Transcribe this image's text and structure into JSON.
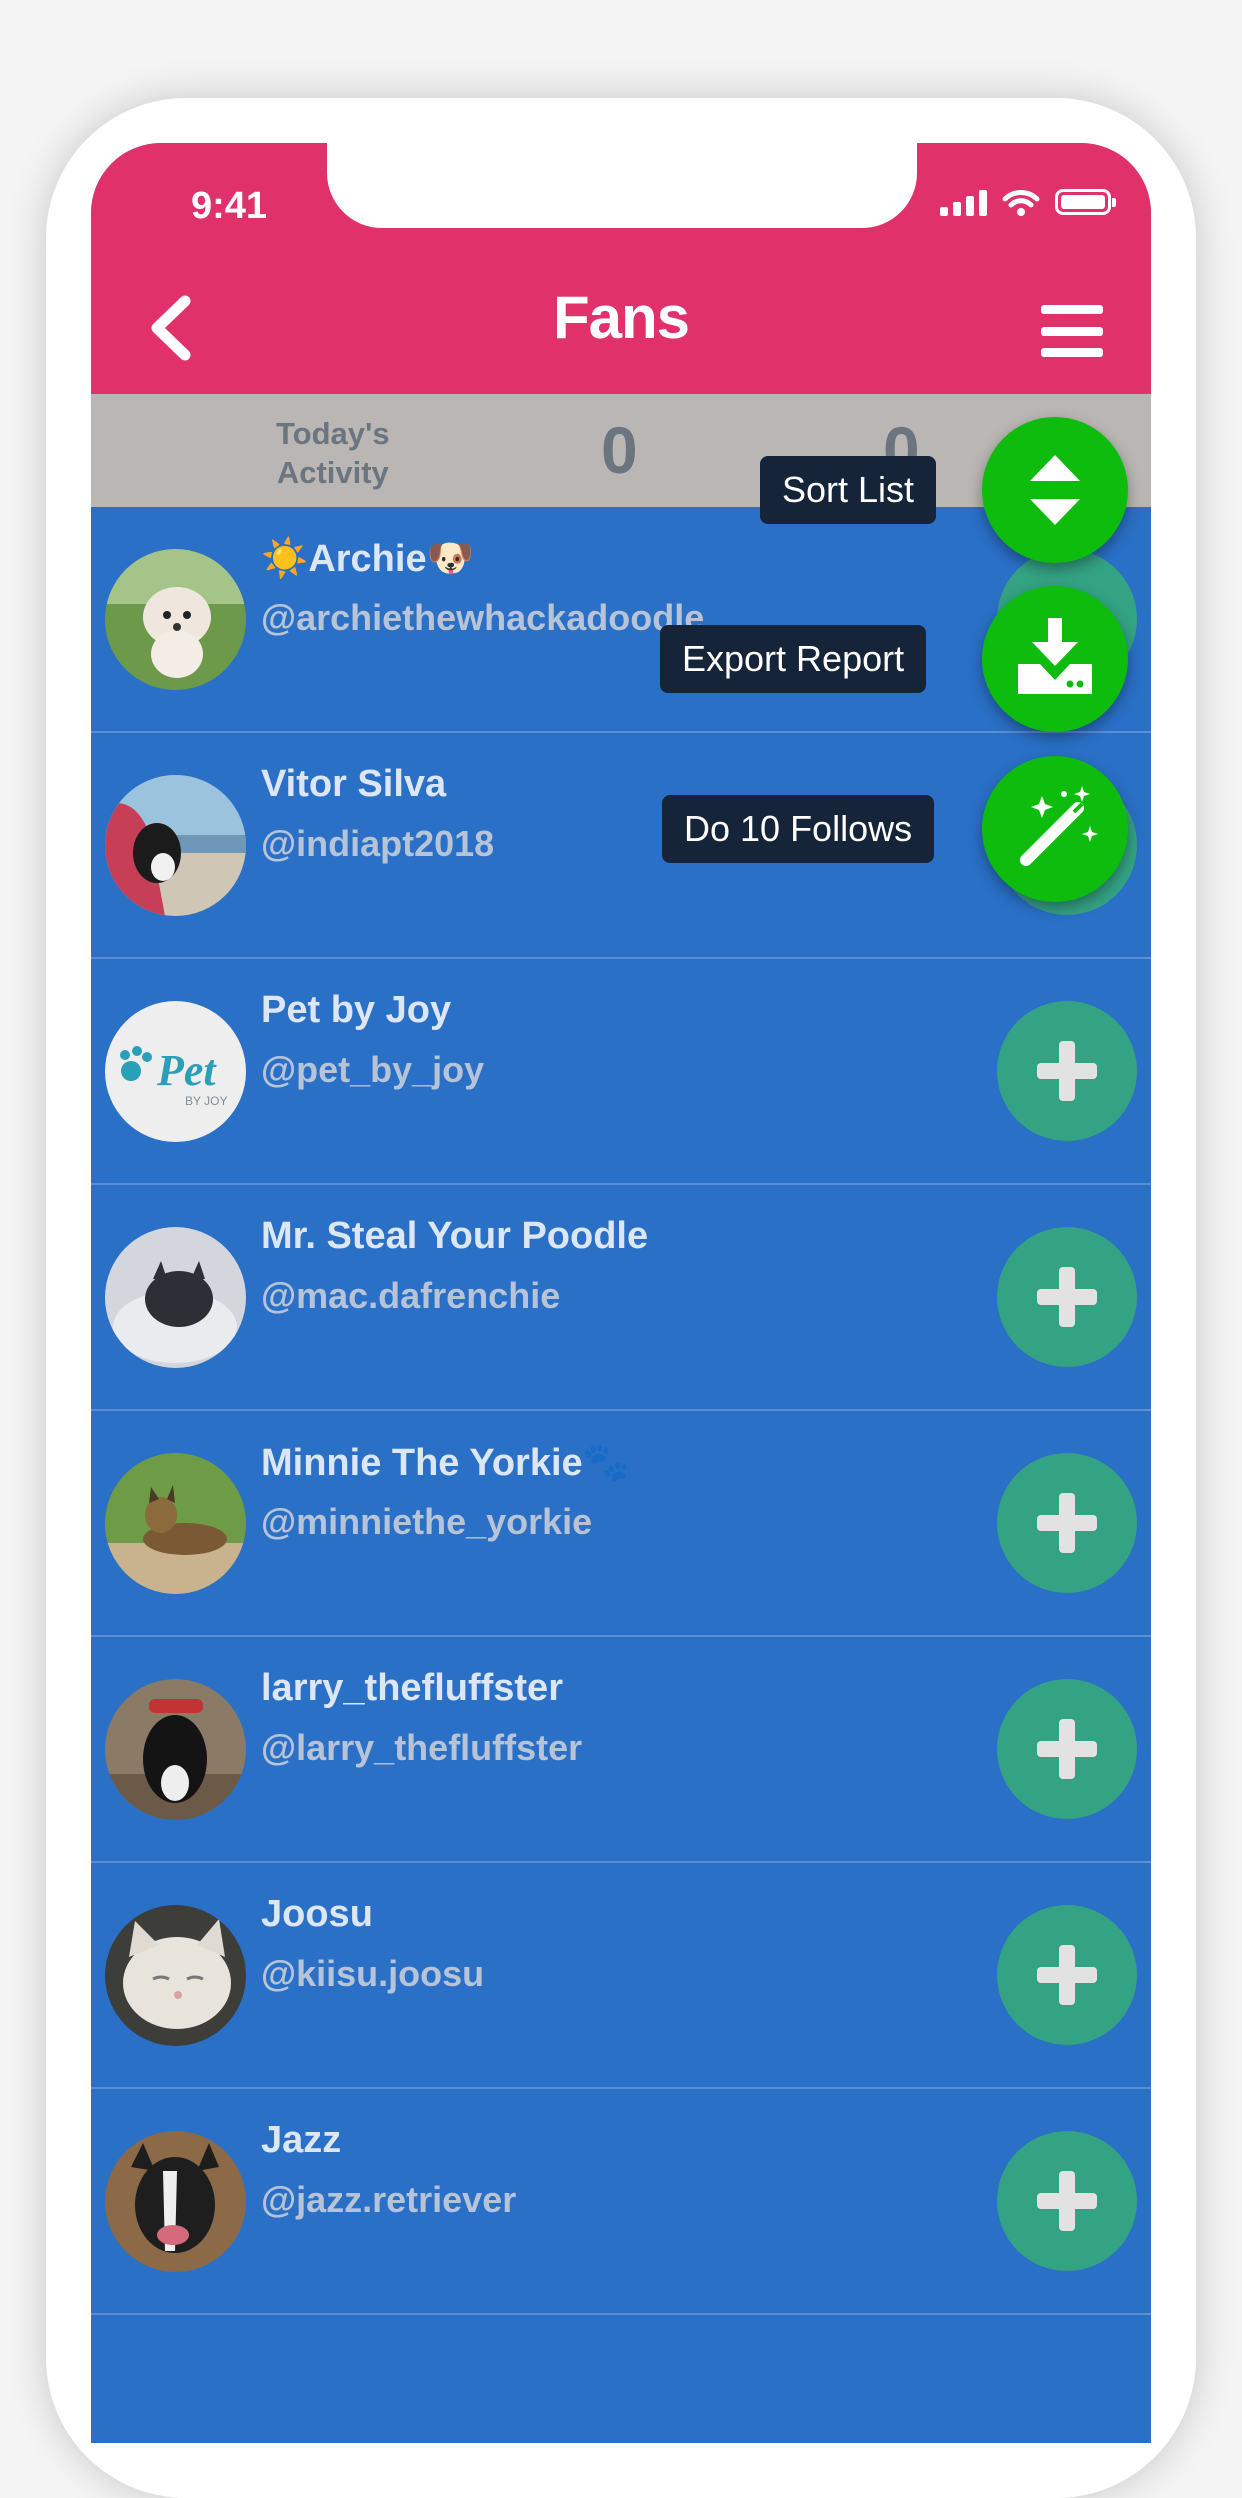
{
  "status_bar": {
    "time": "9:41"
  },
  "header": {
    "title": "Fans"
  },
  "activity": {
    "label_line1": "Today's",
    "label_line2": "Activity",
    "count1": "0",
    "count2": "0"
  },
  "fab_menu": {
    "sort_label": "Sort List",
    "export_label": "Export Report",
    "follow_label": "Do 10 Follows"
  },
  "fans": [
    {
      "name": "☀️Archie🐶",
      "handle": "@archiethewhackadoodle"
    },
    {
      "name": "Vitor Silva",
      "handle": "@indiapt2018"
    },
    {
      "name": "Pet by Joy",
      "handle": "@pet_by_joy",
      "avatar_text": "Pet",
      "avatar_subtext": "BY JOY"
    },
    {
      "name": "Mr. Steal Your Poodle",
      "handle": "@mac.dafrenchie"
    },
    {
      "name": "Minnie The Yorkie🐾",
      "handle": "@minniethe_yorkie"
    },
    {
      "name": "larry_thefluffster",
      "handle": "@larry_thefluffster"
    },
    {
      "name": "Joosu",
      "handle": "@kiisu.joosu"
    },
    {
      "name": "Jazz",
      "handle": "@jazz.retriever"
    }
  ],
  "colors": {
    "header": "#e0316b",
    "list_bg": "#2a70c7",
    "fab": "#0ebc0e",
    "follow_button": "#34a384"
  }
}
